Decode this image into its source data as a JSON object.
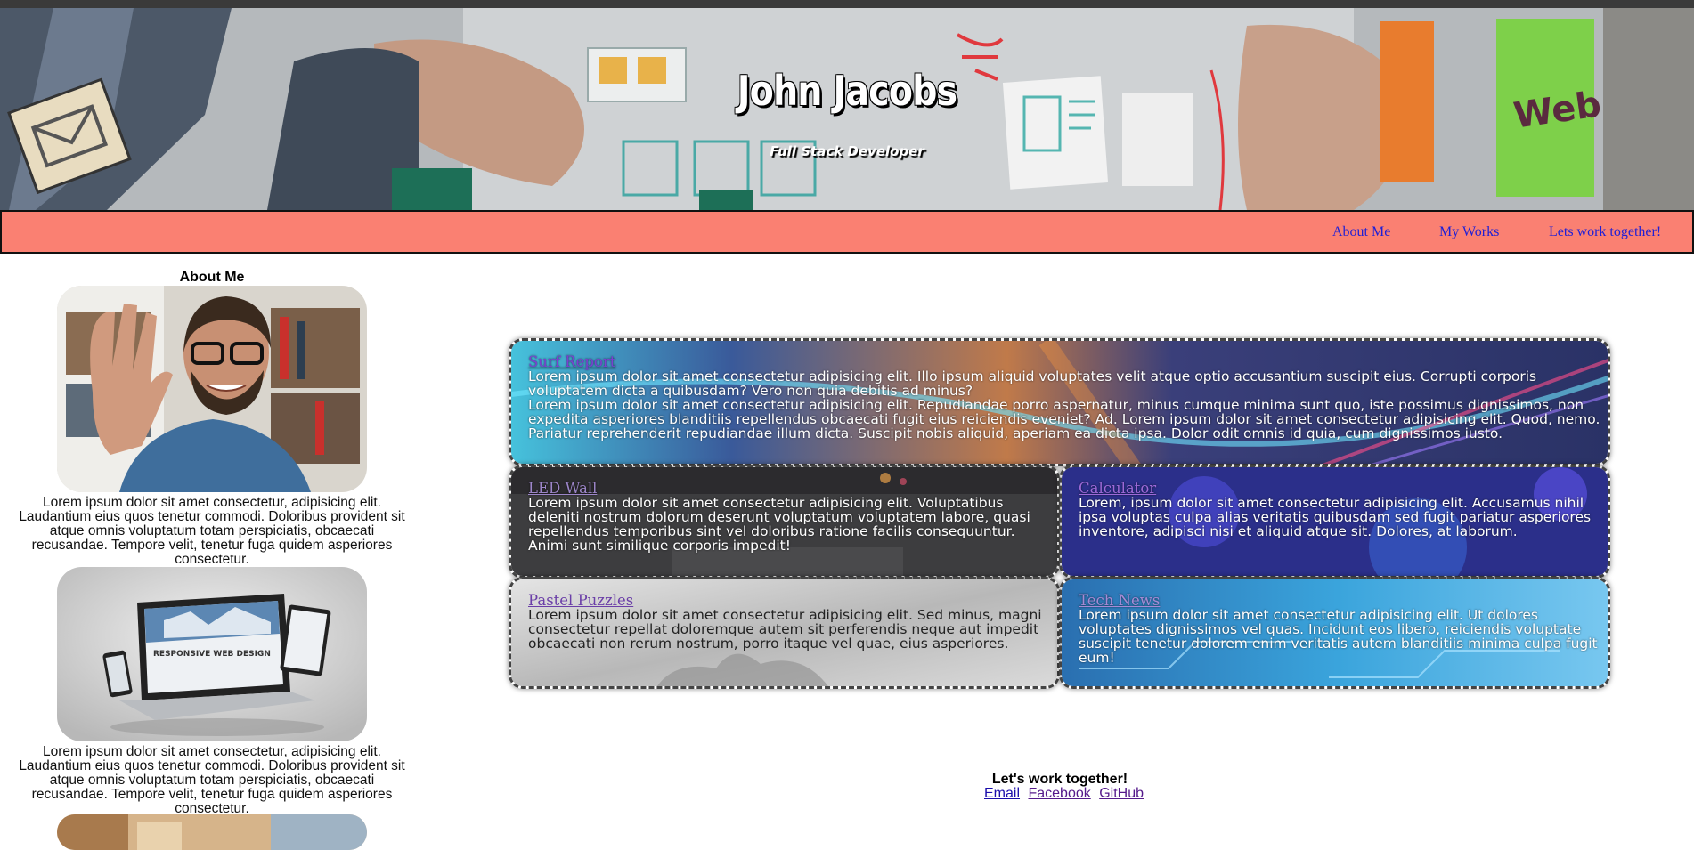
{
  "hero": {
    "title": "John Jacobs",
    "subtitle": "Full Stack Developer",
    "sticky_note_text": "Web"
  },
  "nav": {
    "items": [
      {
        "label": "About Me"
      },
      {
        "label": "My Works"
      },
      {
        "label": "Lets work together!"
      }
    ]
  },
  "aside": {
    "heading": "About Me",
    "bio_1": "Lorem ipsum dolor sit amet consectetur, adipisicing elit. Laudantium eius quos tenetur commodi. Doloribus provident sit atque omnis voluptatum totam perspiciatis, obcaecati recusandae. Tempore velit, tenetur fuga quidem asperiores consectetur.",
    "bio_2": "Lorem ipsum dolor sit amet consectetur, adipisicing elit. Laudantium eius quos tenetur commodi. Doloribus provident sit atque omnis voluptatum totam perspiciatis, obcaecati recusandae. Tempore velit, tenetur fuga quidem asperiores consectetur.",
    "device_screen_text": "RESPONSIVE WEB DESIGN"
  },
  "projects": [
    {
      "title": "Surf Report",
      "text_1": "Lorem ipsum dolor sit amet consectetur adipisicing elit. Illo ipsum aliquid voluptates velit atque optio accusantium suscipit eius. Corrupti corporis voluptatem dicta a quibusdam? Vero non quia debitis ad minus?",
      "text_2": "Lorem ipsum dolor sit amet consectetur adipisicing elit. Repudiandae porro aspernatur, minus cumque minima sunt quo, iste possimus dignissimos, non expedita asperiores blanditiis repellendus obcaecati fugit eius reiciendis eveniet? Ad. Lorem ipsum dolor sit amet consectetur adipisicing elit. Quod, nemo. Pariatur reprehenderit repudiandae illum dicta. Suscipit nobis aliquid, aperiam ea dicta ipsa. Dolor odit omnis id quia, cum dignissimos iusto."
    },
    {
      "title": "LED Wall",
      "text": "Lorem ipsum dolor sit amet consectetur adipisicing elit. Voluptatibus deleniti nostrum dolorum deserunt voluptatum voluptatem labore, quasi repellendus temporibus sint vel doloribus ratione facilis consequuntur. Animi sunt similique corporis impedit!"
    },
    {
      "title": "Calculator",
      "text": "Lorem, ipsum dolor sit amet consectetur adipisicing elit. Accusamus nihil ipsa voluptas culpa alias veritatis quibusdam sed fugit pariatur asperiores inventore, adipisci nisi et aliquid atque sit. Dolores, at laborum."
    },
    {
      "title": "Pastel Puzzles",
      "text": "Lorem ipsum dolor sit amet consectetur adipisicing elit. Sed minus, magni consectetur repellat doloremque autem sit perferendis neque aut impedit obcaecati non rerum nostrum, porro itaque vel quae, eius asperiores."
    },
    {
      "title": "Tech News",
      "text": "Lorem ipsum dolor sit amet consectetur adipisicing elit. Ut dolores voluptates dignissimos vel quas. Incidunt eos libero, reiciendis voluptate suscipit tenetur dolorem enim veritatis autem blanditiis minima culpa fugit eum!"
    }
  ],
  "footer": {
    "heading": "Let's work together!",
    "links": [
      {
        "label": "Email"
      },
      {
        "label": "Facebook"
      },
      {
        "label": "GitHub"
      }
    ]
  },
  "colors": {
    "nav_background": "#fa8072",
    "link_blue": "#1f1fd6",
    "link_visited": "#551a8b"
  }
}
